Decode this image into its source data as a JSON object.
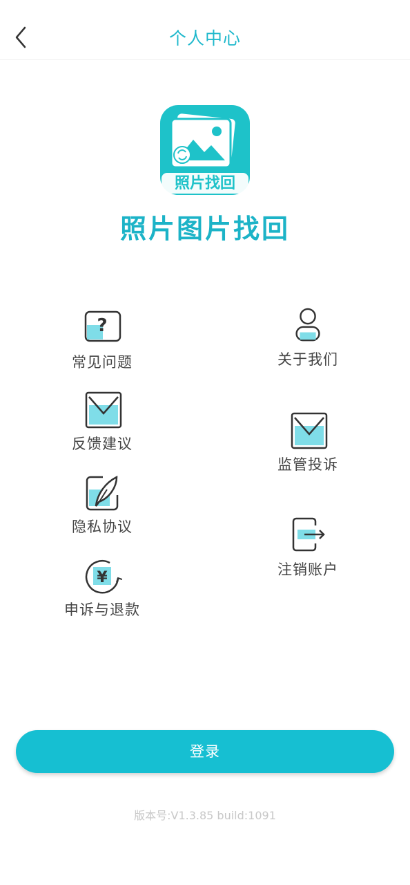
{
  "header": {
    "title": "个人中心"
  },
  "app": {
    "logo_text": "照片找回",
    "name": "照片图片找回"
  },
  "menu": {
    "faq": "常见问题",
    "about": "关于我们",
    "feedback": "反馈建议",
    "supervision": "监管投诉",
    "privacy": "隐私协议",
    "cancel_account": "注销账户",
    "refund": "申诉与退款",
    "refund_icon_symbol": "¥"
  },
  "login": {
    "label": "登录"
  },
  "version": "版本号:V1.3.85 build:1091",
  "colors": {
    "accent": "#16bfd2",
    "title": "#1eb8cc",
    "icon_fill": "#7fdde8"
  }
}
